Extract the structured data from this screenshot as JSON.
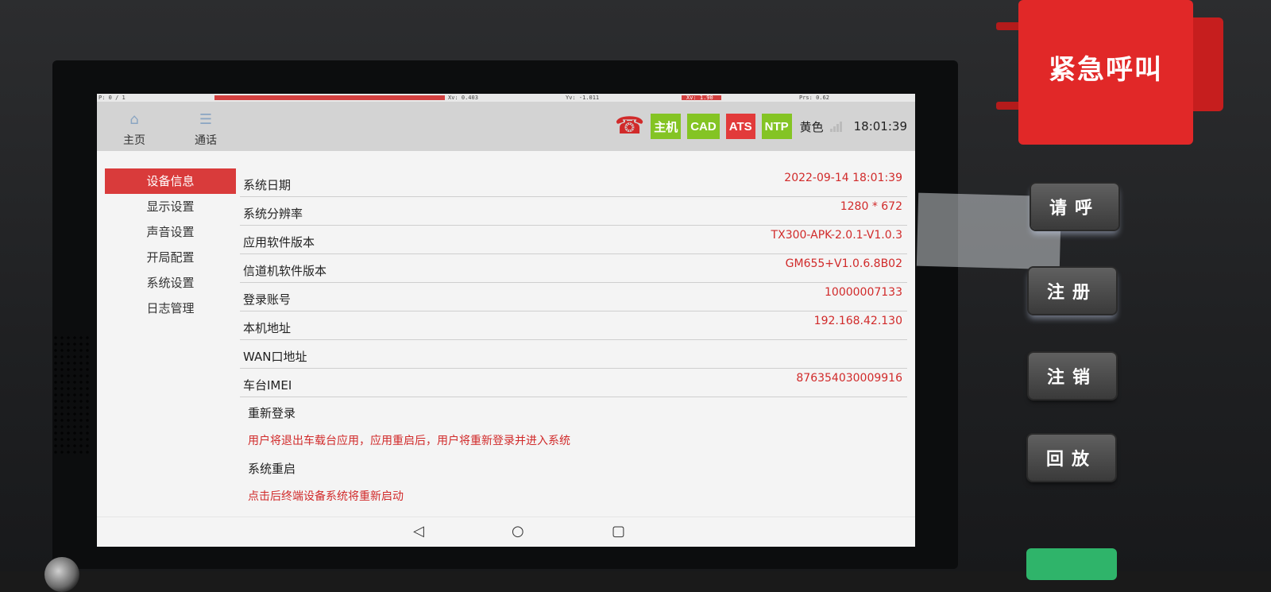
{
  "debug": {
    "p": "P: 0 / 1",
    "xv": "Xv: 0.403",
    "yv": "Yv: -1.011",
    "red_value": "Xv: 1.90",
    "prs": "Prs: 0.62"
  },
  "header": {
    "nav": [
      {
        "label": "主页",
        "icon": "home-icon"
      },
      {
        "label": "通话",
        "icon": "list-icon"
      }
    ],
    "status": {
      "phone_icon": "phone-icon",
      "badges": [
        {
          "label": "主机",
          "color": "#84c424"
        },
        {
          "label": "CAD",
          "color": "#84c424"
        },
        {
          "label": "ATS",
          "color": "#e23a3a"
        },
        {
          "label": "NTP",
          "color": "#84c424"
        }
      ],
      "yellow_text": "黄色",
      "signal_icon": "signal-icon",
      "time": "18:01:39"
    }
  },
  "sidebar": {
    "items": [
      {
        "label": "设备信息",
        "active": true
      },
      {
        "label": "显示设置",
        "active": false
      },
      {
        "label": "声音设置",
        "active": false
      },
      {
        "label": "开局配置",
        "active": false
      },
      {
        "label": "系统设置",
        "active": false
      },
      {
        "label": "日志管理",
        "active": false
      }
    ]
  },
  "info": {
    "rows": [
      {
        "key": "系统日期",
        "value": "2022-09-14 18:01:39"
      },
      {
        "key": "系统分辨率",
        "value": "1280 * 672"
      },
      {
        "key": "应用软件版本",
        "value": "TX300-APK-2.0.1-V1.0.3"
      },
      {
        "key": "信道机软件版本",
        "value": "GM655+V1.0.6.8B02"
      },
      {
        "key": "登录账号",
        "value": "10000007133"
      },
      {
        "key": "本机地址",
        "value": "192.168.42.130"
      },
      {
        "key": "WAN口地址",
        "value": ""
      },
      {
        "key": "车台IMEI",
        "value": "876354030009916"
      }
    ],
    "relogin_label": "重新登录",
    "relogin_note": "用户将退出车载台应用，应用重启后，用户将重新登录并进入系统",
    "reboot_label": "系统重启",
    "reboot_note": "点击后终端设备系统将重新启动"
  },
  "navbar": {
    "back_icon": "back-icon",
    "home_icon": "home-circle-icon",
    "recents_icon": "recents-icon"
  },
  "hardware": {
    "emergency_label": "紧急呼叫",
    "buttons": [
      {
        "label": "请呼"
      },
      {
        "label": "注册"
      },
      {
        "label": "注销"
      },
      {
        "label": "回放"
      }
    ]
  }
}
